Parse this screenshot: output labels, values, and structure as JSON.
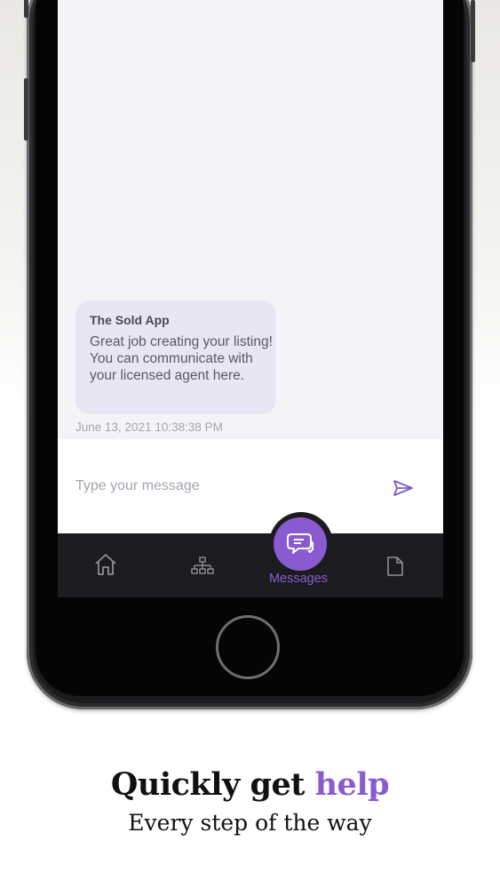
{
  "chat": {
    "sender": "The Sold App",
    "message": "Great job creating your listing! You can communicate with your licensed agent here.",
    "timestamp": "June 13, 2021 10:38:38 PM"
  },
  "composer": {
    "placeholder": "Type your message"
  },
  "tabbar": {
    "items": [
      {
        "icon": "home-icon"
      },
      {
        "icon": "sitemap-icon"
      },
      {
        "icon": "chat-bubbles-icon",
        "label": "Messages",
        "active": true
      },
      {
        "icon": "document-icon"
      }
    ]
  },
  "marketing": {
    "headline_prefix": "Quickly get ",
    "headline_accent": "help",
    "subheadline": "Every step of the way"
  },
  "colors": {
    "accent": "#8a5bd0",
    "bubble": "#e8e6f3",
    "tabbar": "#1c1c20"
  }
}
